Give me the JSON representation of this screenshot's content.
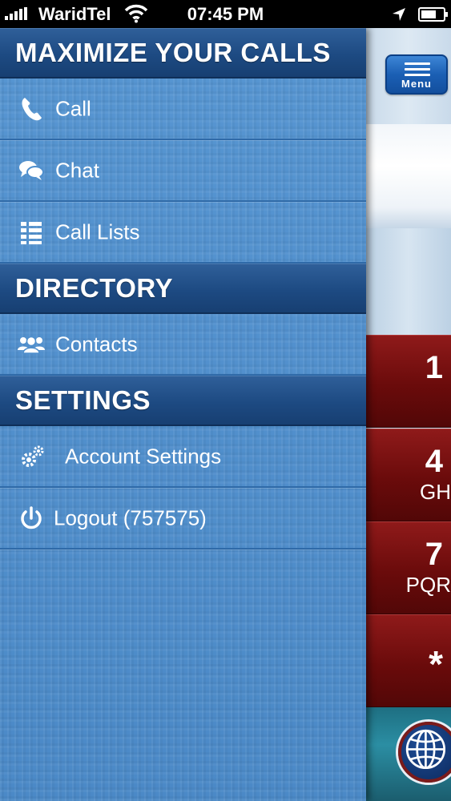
{
  "status_bar": {
    "carrier": "WaridTel",
    "time": "07:45 PM"
  },
  "menu_button": {
    "label": "Menu"
  },
  "sections": [
    {
      "title": "MAXIMIZE YOUR CALLS",
      "items": [
        {
          "label": "Call",
          "icon": "phone-icon"
        },
        {
          "label": "Chat",
          "icon": "chat-bubbles-icon"
        },
        {
          "label": "Call Lists",
          "icon": "list-icon"
        }
      ]
    },
    {
      "title": "DIRECTORY",
      "items": [
        {
          "label": "Contacts",
          "icon": "contacts-icon"
        }
      ]
    },
    {
      "title": "SETTINGS",
      "items": [
        {
          "label": "Account Settings",
          "icon": "gears-icon"
        },
        {
          "label": "Logout (757575)",
          "icon": "power-icon"
        }
      ]
    }
  ],
  "keypad": [
    {
      "number": "1",
      "letters": ""
    },
    {
      "number": "4",
      "letters": "GH"
    },
    {
      "number": "7",
      "letters": "PQR"
    },
    {
      "number": "*",
      "letters": ""
    }
  ],
  "colors": {
    "menu_background": "#4f8fcd",
    "header_background": "#1d4a82",
    "key_background": "#6a0b0b",
    "menu_button": "#1b5fb4"
  }
}
